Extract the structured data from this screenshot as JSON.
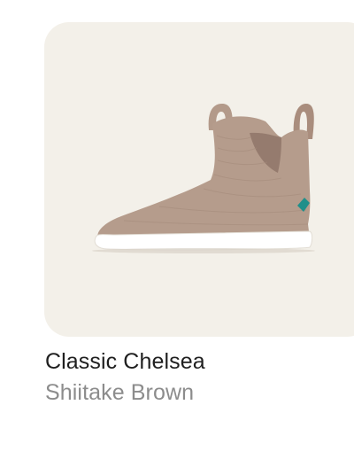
{
  "product": {
    "name": "Classic Chelsea",
    "color_name": "Shiitake Brown",
    "image_icon": "chelsea-boot-image",
    "colors": {
      "card_background": "#f3f0e9",
      "shoe_upper": "#b59c8c",
      "shoe_sole": "#ffffff",
      "tag_accent": "#1f8f8a"
    }
  }
}
